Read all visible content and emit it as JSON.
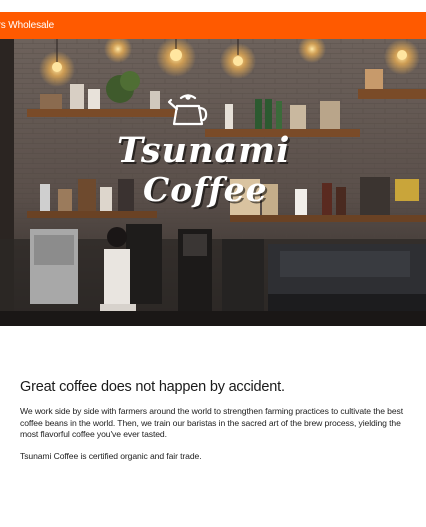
{
  "colors": {
    "accent": "#ff5a00",
    "text": "#1a1a1a",
    "brand_text": "#ffffff"
  },
  "topbar": {
    "link_label": "urs Wholesale"
  },
  "hero": {
    "icon": "coffee-kettle-icon",
    "brand_line1": "Tsunami",
    "brand_line2": "Coffee"
  },
  "content": {
    "headline": "Great coffee does not happen by accident.",
    "paragraph1": "We work side by side with farmers around the world to strengthen farming practices to cultivate the best coffee beans in the world. Then, we train our baristas in the sacred art of the brew process, yielding the most flavorful coffee you've ever tasted.",
    "paragraph2": "Tsunami Coffee is certified organic and fair trade."
  }
}
